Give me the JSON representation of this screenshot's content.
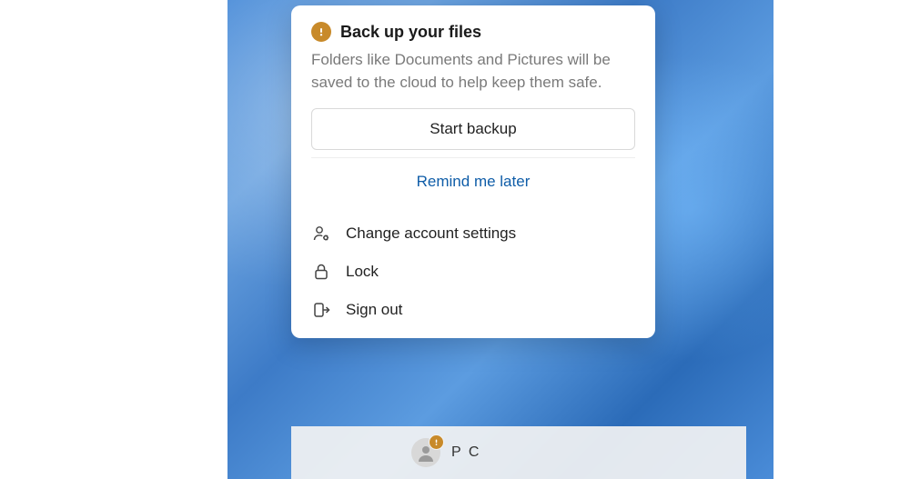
{
  "popup": {
    "title": "Back up your files",
    "description": "Folders like Documents and Pictures will be saved to the cloud to help keep them safe.",
    "primary_button": "Start backup",
    "secondary_button": "Remind me later"
  },
  "menu": {
    "items": [
      {
        "label": "Change account settings",
        "icon": "user-gear-icon"
      },
      {
        "label": "Lock",
        "icon": "lock-icon"
      },
      {
        "label": "Sign out",
        "icon": "sign-out-icon"
      }
    ]
  },
  "taskbar": {
    "user_name": "P C"
  },
  "colors": {
    "warning": "#c88a2a",
    "link": "#0f5da8"
  }
}
